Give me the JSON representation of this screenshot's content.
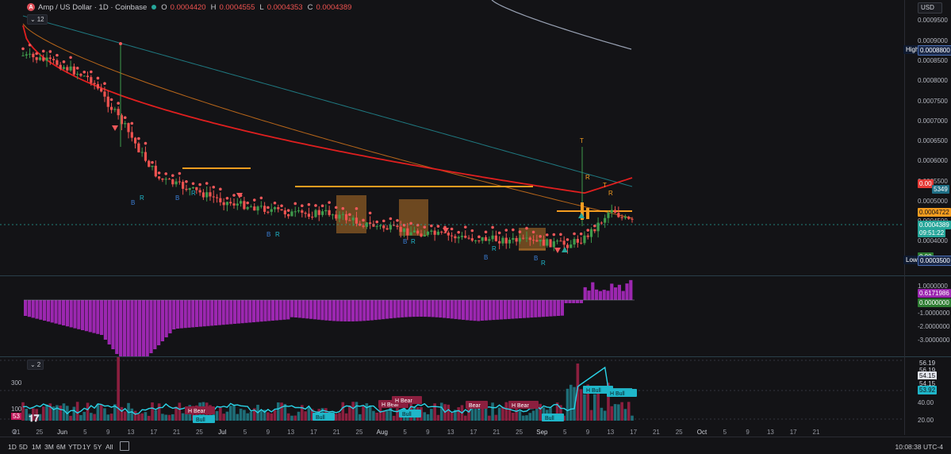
{
  "legend": {
    "symbol_letter": "A",
    "title": "Amp / US Dollar · 1D · Coinbase",
    "o_key": "O",
    "o_val": "0.0004420",
    "h_key": "H",
    "h_val": "0.0004555",
    "l_key": "L",
    "l_val": "0.0004353",
    "c_key": "C",
    "c_val": "0.0004389",
    "indicator_count": "12"
  },
  "currency": "USD",
  "price_axis": {
    "ticks": [
      "0.0009500",
      "0.0009000",
      "0.0008500",
      "0.0008000",
      "0.0007500",
      "0.0007000",
      "0.0006500",
      "0.0006000",
      "0.0005500",
      "0.0005000",
      "0.0004500",
      "0.0004000",
      "0.0003500"
    ],
    "high_label": "High",
    "high_value": "0.0008800",
    "low_label": "Low",
    "low_value": "0.0003500",
    "red_value": "0.00",
    "blue_value": "5349",
    "orange_value": "0.0004722",
    "last_value": "0.0004389",
    "countdown": "09:51:22",
    "green_value": "0.00"
  },
  "osc_axis": {
    "ticks": [
      "1.0000000",
      "-1.0000000",
      "-2.0000000",
      "-3.0000000"
    ],
    "purple_value": "0.6171986",
    "green_value": "0.0000000"
  },
  "vol_panel": {
    "indicator_count": "2",
    "left_ticks": [
      "300",
      "100"
    ],
    "left_badge": "53",
    "right_ticks": [
      "56.19",
      "54.15",
      "40.00",
      "20.00"
    ],
    "label_56": "56.19",
    "label_54": "54.15",
    "label_53": "53.92",
    "signals": [
      {
        "text": "H Bear",
        "type": "bear"
      },
      {
        "text": "Bull",
        "type": "bull"
      },
      {
        "text": "Bull",
        "type": "bull"
      },
      {
        "text": "H Bear",
        "type": "bear"
      },
      {
        "text": "H Bear",
        "type": "bear"
      },
      {
        "text": "Bull",
        "type": "bull"
      },
      {
        "text": "Bear",
        "type": "bear"
      },
      {
        "text": "H Bear",
        "type": "bear"
      },
      {
        "text": "Bull",
        "type": "bull"
      },
      {
        "text": "H Bull",
        "type": "bull"
      },
      {
        "text": "H Bull",
        "type": "bull"
      }
    ]
  },
  "chart_marks": {
    "b_label": "B",
    "r_label": "R",
    "t_label": "T"
  },
  "time_axis": [
    "21",
    "25",
    "Jun",
    "5",
    "9",
    "13",
    "17",
    "21",
    "25",
    "Jul",
    "5",
    "9",
    "13",
    "17",
    "21",
    "25",
    "Aug",
    "5",
    "9",
    "13",
    "17",
    "21",
    "25",
    "Sep",
    "5",
    "9",
    "13",
    "17",
    "21",
    "25",
    "Oct",
    "5",
    "9",
    "13",
    "17",
    "21"
  ],
  "ranges": [
    "1D",
    "5D",
    "1M",
    "3M",
    "6M",
    "YTD",
    "1Y",
    "5Y",
    "All"
  ],
  "clock": "10:08:38 UTC-4",
  "colors": {
    "up": "#3f9b4c",
    "down": "#ef5350",
    "red_line": "#e01f1f",
    "orange_line": "#b8661a",
    "teal_line": "#1f7a82",
    "purple": "#9c27b0",
    "orange_box": "#b8742a",
    "volume_teal": "#1e6e78",
    "volume_red": "#8c1f3f"
  }
}
